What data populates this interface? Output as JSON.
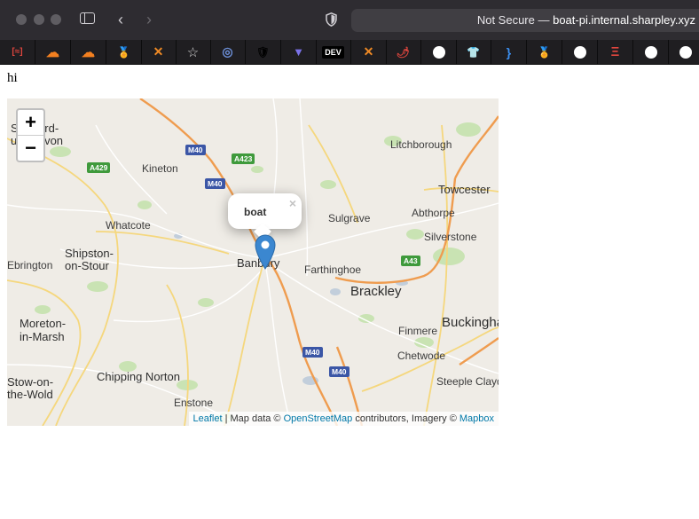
{
  "browser": {
    "url_prefix": "Not Secure — ",
    "url_host": "boat-pi.internal.sharpley.xyz",
    "favorites": [
      "[≈]",
      "☁",
      "☁",
      "🏅",
      "✕",
      "☆",
      "◎",
      "🛡",
      "▼",
      "DEV",
      "✕",
      "🌶",
      "",
      "👕",
      "}",
      "🏅",
      "",
      "Ξ",
      "",
      ""
    ]
  },
  "page": {
    "text": "hi"
  },
  "map": {
    "zoom_in_label": "+",
    "zoom_out_label": "−",
    "popup": {
      "text": "boat",
      "close_label": "×"
    },
    "places": {
      "stratford": "Stratford-",
      "upon_avon": "u  on-Avon",
      "kineton": "Kineton",
      "lichborough": "Litchborough",
      "towcester": "Towcester",
      "whatcote": "Whatcote",
      "sulgrave": "Sulgrave",
      "abthorpe": "Abthorpe",
      "silverstone": "Silverstone",
      "shipston": "Shipston-",
      "on_stour": "on-Stour",
      "ebrington": "Ebrington",
      "banbury": "Banbury",
      "farthinghoe": "Farthinghoe",
      "brackley": "Brackley",
      "moreton": "Moreton-",
      "in_marsh": "in-Marsh",
      "finmere": "Finmere",
      "buckingham": "Buckinghan",
      "chetwode": "Chetwode",
      "stow": "Stow-on-",
      "the_wold": "the-Wold",
      "chipping_norton": "Chipping Norton",
      "steeple_claydon": "Steeple Claydor",
      "enstone": "Enstone"
    },
    "roads": {
      "m40_a": "M40",
      "m40_b": "M40",
      "m40_c": "M40",
      "m40_d": "M40",
      "a423": "A423",
      "a429": "A429",
      "a43": "A43"
    },
    "attribution": {
      "leaflet": "Leaflet",
      "sep1": " | Map data © ",
      "osm": "OpenStreetMap",
      "sep2": " contributors, Imagery © ",
      "mapbox": "Mapbox"
    }
  }
}
